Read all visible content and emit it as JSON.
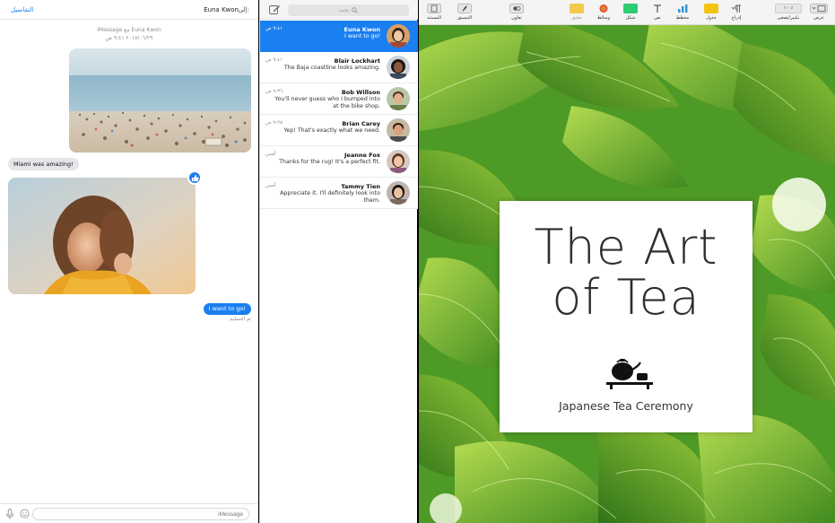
{
  "messages": {
    "header": {
      "details_link": "التفاصيل",
      "to_label": "إلى:",
      "to_name": "Euna Kwon"
    },
    "thread_meta": {
      "service_line": "iMessage مع Euna Kwon",
      "timestamp": "٢٠١٧/٠٦/٢٩ ٩:٤١ ص"
    },
    "bubbles": {
      "received_text": "Miami was amazing!",
      "sent_text": "I want to go!",
      "delivered_status": "تم التسليم"
    },
    "compose": {
      "placeholder": "iMessage"
    }
  },
  "conversations": {
    "search_placeholder": "بحث",
    "items": [
      {
        "name": "Euna Kwon",
        "time": "٩:٤١ ص",
        "preview": "I want to go!",
        "selected": true
      },
      {
        "name": "Blair Lockhart",
        "time": "٩:٤١ ص",
        "preview": "The Baja coastline looks amazing.",
        "selected": false
      },
      {
        "name": "Bob Willson",
        "time": "٩:٣٦ ص",
        "preview": "You'll never guess who I bumped into at the bike shop.",
        "selected": false
      },
      {
        "name": "Brian Carey",
        "time": "٩:٢٨ ص",
        "preview": "Yep! That's exactly what we need.",
        "selected": false
      },
      {
        "name": "Jeanne Fox",
        "time": "أمس",
        "preview": "Thanks for the rug! It's a perfect fit.",
        "selected": false
      },
      {
        "name": "Tammy Tien",
        "time": "أمس",
        "preview": "Appreciate it. I'll definitely look into them.",
        "selected": false
      }
    ]
  },
  "keynote": {
    "toolbar": {
      "view": "عرض",
      "zoom": "تكبير/تصغير",
      "zoom_value": "١٠٠٪",
      "add_slide": "إدراج",
      "table": "جدول",
      "chart": "مخطط",
      "text": "نص",
      "shape": "شكل",
      "media": "وسائط",
      "comment": "تعليق",
      "collaborate": "تعاون",
      "format": "التنسيق",
      "document": "المستند"
    },
    "slide": {
      "title_line1": "The Art",
      "title_line2": "of Tea",
      "subtitle": "Japanese Tea Ceremony"
    }
  },
  "colors": {
    "accent": "#1a7ff0",
    "received_bubble": "#e5e5ea",
    "leaf_green": "#5fa82a"
  }
}
